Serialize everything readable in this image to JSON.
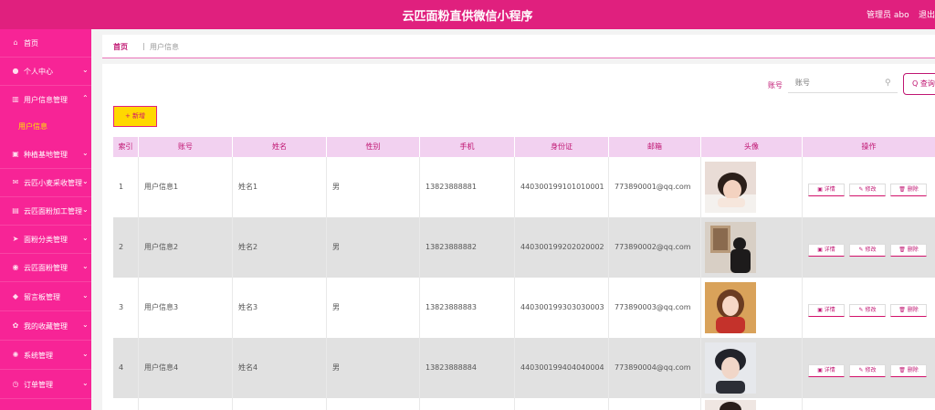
{
  "header": {
    "title": "云匹面粉直供微信小程序",
    "admin": "管理员 abo",
    "logout": "退出"
  },
  "sidebar": {
    "items": [
      {
        "label": "首页",
        "icon": "home-icon",
        "glyph": "⌂",
        "chevron": ""
      },
      {
        "label": "个人中心",
        "icon": "user-icon",
        "glyph": "●",
        "chevron": "⌄"
      },
      {
        "label": "用户信息管理",
        "icon": "chart-icon",
        "glyph": "▥",
        "chevron": "⌃"
      },
      {
        "label": "种植基地管理",
        "icon": "monitor-icon",
        "glyph": "▣",
        "chevron": "⌄"
      },
      {
        "label": "云匹小麦采收管理",
        "icon": "mail-icon",
        "glyph": "✉",
        "chevron": "⌄"
      },
      {
        "label": "云匹面粉加工管理",
        "icon": "screen-icon",
        "glyph": "▤",
        "chevron": "⌄"
      },
      {
        "label": "面粉分类管理",
        "icon": "send-icon",
        "glyph": "➤",
        "chevron": "⌄"
      },
      {
        "label": "云匹面粉管理",
        "icon": "location-icon",
        "glyph": "◉",
        "chevron": "⌄"
      },
      {
        "label": "留言板管理",
        "icon": "shield-icon",
        "glyph": "◆",
        "chevron": "⌄"
      },
      {
        "label": "我的收藏管理",
        "icon": "star-icon",
        "glyph": "✿",
        "chevron": "⌄"
      },
      {
        "label": "系统管理",
        "icon": "gear-icon",
        "glyph": "✺",
        "chevron": "⌄"
      },
      {
        "label": "订单管理",
        "icon": "clock-icon",
        "glyph": "◷",
        "chevron": "⌄"
      }
    ],
    "sub_item": "用户信息"
  },
  "breadcrumb": {
    "home": "首页",
    "sep": "|",
    "current": "用户信息"
  },
  "search": {
    "label": "账号",
    "placeholder": "账号",
    "button": "Q 查询"
  },
  "add_button": "+ 新增",
  "table": {
    "headers": [
      "索引",
      "账号",
      "姓名",
      "性别",
      "手机",
      "身份证",
      "邮箱",
      "头像",
      "操作"
    ],
    "rows": [
      {
        "index": "1",
        "account": "用户信息1",
        "name": "姓名1",
        "gender": "男",
        "phone": "13823888881",
        "id_card": "440300199101010001",
        "email": "773890001@qq.com"
      },
      {
        "index": "2",
        "account": "用户信息2",
        "name": "姓名2",
        "gender": "男",
        "phone": "13823888882",
        "id_card": "440300199202020002",
        "email": "773890002@qq.com"
      },
      {
        "index": "3",
        "account": "用户信息3",
        "name": "姓名3",
        "gender": "男",
        "phone": "13823888883",
        "id_card": "440300199303030003",
        "email": "773890003@qq.com"
      },
      {
        "index": "4",
        "account": "用户信息4",
        "name": "姓名4",
        "gender": "男",
        "phone": "13823888884",
        "id_card": "440300199404040004",
        "email": "773890004@qq.com"
      }
    ],
    "actions": {
      "detail": "▣ 详情",
      "edit": "✎ 修改",
      "delete": "🗑 删除"
    }
  },
  "colors": {
    "header_bg": "#e0207e",
    "sidebar_bg": "#f72496",
    "accent": "#c01672",
    "table_header_bg": "#f2d1f0",
    "active_sub": "#ffe400",
    "add_btn": "#ffd800"
  }
}
